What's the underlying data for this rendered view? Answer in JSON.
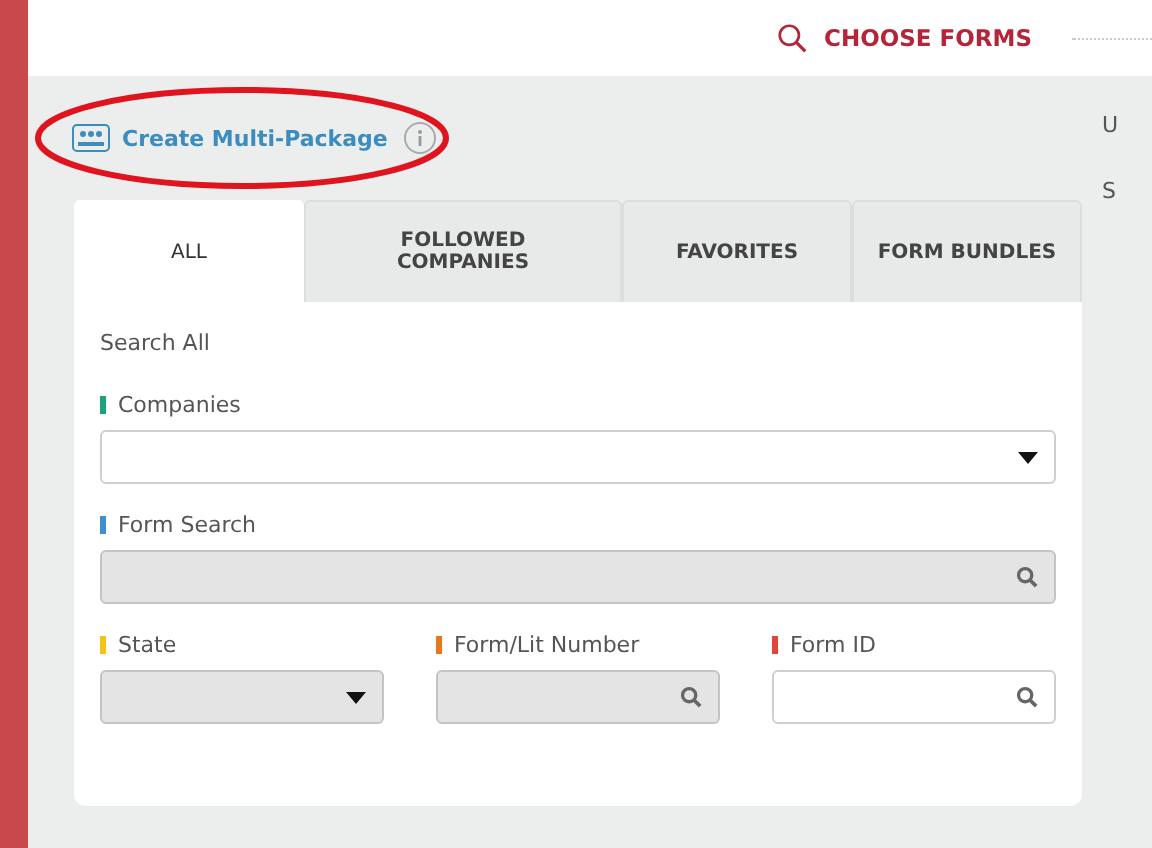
{
  "header": {
    "title": "CHOOSE FORMS"
  },
  "create_link": {
    "label": "Create Multi-Package",
    "circled": true
  },
  "side_cut_letters": [
    "U",
    "S"
  ],
  "tabs": [
    {
      "label": "ALL",
      "selected": true
    },
    {
      "label": "FOLLOWED COMPANIES",
      "selected": false
    },
    {
      "label": "FAVORITES",
      "selected": false
    },
    {
      "label": "FORM BUNDLES",
      "selected": false
    }
  ],
  "section_title": "Search All",
  "field_rows": [
    [
      {
        "label": "Companies",
        "color": "#1aa37a",
        "kind": "select",
        "disabled": false
      }
    ],
    [
      {
        "label": "Form Search",
        "color": "#3d8fd0",
        "kind": "search",
        "disabled": true
      }
    ],
    [
      {
        "label": "State",
        "color": "#f2c417",
        "kind": "select",
        "disabled": true
      },
      {
        "label": "Form/Lit Number",
        "color": "#e8761c",
        "kind": "search",
        "disabled": true
      },
      {
        "label": "Form ID",
        "color": "#e0443a",
        "kind": "search",
        "disabled": false
      }
    ]
  ]
}
